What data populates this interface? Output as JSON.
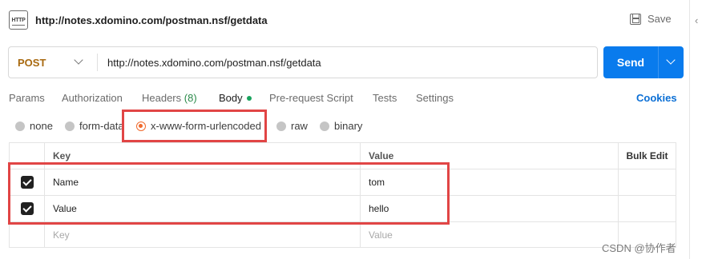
{
  "request": {
    "icon_label": "HTTP",
    "icon": "http-request-icon",
    "title": "http://notes.xdomino.com/postman.nsf/getdata",
    "save_label": "Save"
  },
  "urlbar": {
    "method": "POST",
    "url": "http://notes.xdomino.com/postman.nsf/getdata",
    "send_label": "Send"
  },
  "tabs": [
    {
      "label": "Params"
    },
    {
      "label": "Authorization"
    },
    {
      "label": "Headers",
      "count": "(8)"
    },
    {
      "label": "Body"
    },
    {
      "label": "Pre-request Script"
    },
    {
      "label": "Tests"
    },
    {
      "label": "Settings"
    }
  ],
  "cookies_label": "Cookies",
  "body_types": [
    {
      "label": "none"
    },
    {
      "label": "form-data"
    },
    {
      "label": "x-www-form-urlencoded",
      "selected": true
    },
    {
      "label": "raw"
    },
    {
      "label": "binary"
    }
  ],
  "table": {
    "headers": {
      "key": "Key",
      "value": "Value",
      "bulk_edit": "Bulk Edit"
    },
    "rows": [
      {
        "key": "Name",
        "value": "tom",
        "checked": true
      },
      {
        "key": "Value",
        "value": "hello",
        "checked": true
      }
    ],
    "placeholder": {
      "key": "Key",
      "value": "Value"
    }
  },
  "watermark": "CSDN @协作者",
  "colors": {
    "accent": "#097bed",
    "method": "#a8690f",
    "annotation": "#e14545",
    "selected_radio": "#f06a2d"
  }
}
